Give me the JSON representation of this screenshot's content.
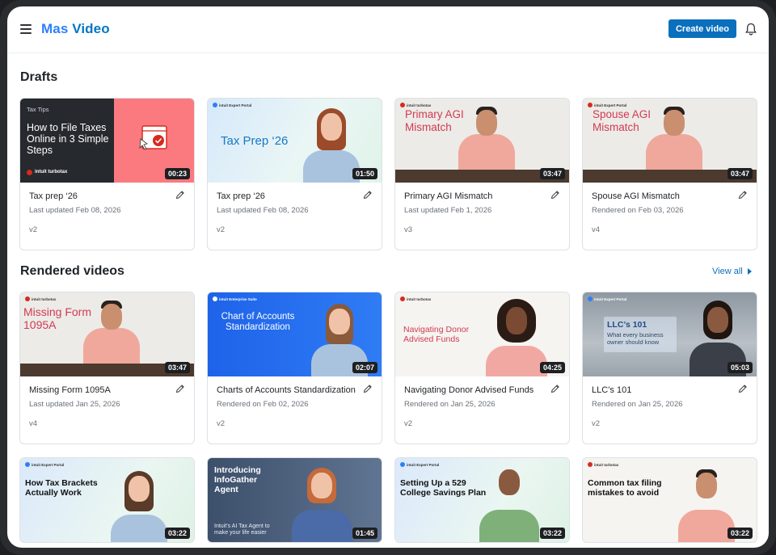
{
  "app": {
    "brand_part1": "Mas ",
    "brand_part2": "Video",
    "create_label": "Create video"
  },
  "sections": {
    "drafts": "Drafts",
    "rendered": "Rendered videos",
    "view_all": "View all"
  },
  "drafts": [
    {
      "title": "Tax prep ‘26",
      "subtitle": "Last updated Feb 08, 2026",
      "version": "v2",
      "duration": "00:23",
      "thumb_text": "How to File Taxes Online in 3 Simple Steps",
      "thumb_tag": "Tax Tips",
      "thumb_logo": "intuit turbotax"
    },
    {
      "title": "Tax prep ‘26",
      "subtitle": "Last updated Feb 08, 2026",
      "version": "v2",
      "duration": "01:50",
      "thumb_text": "Tax Prep ‘26",
      "thumb_logo": "intuit Expert Portal"
    },
    {
      "title": "Primary AGI Mismatch",
      "subtitle": "Last updated Feb 1, 2026",
      "version": "v3",
      "duration": "03:47",
      "thumb_text": "Primary AGI Mismatch",
      "thumb_logo": "intuit turbotax"
    },
    {
      "title": "Spouse AGI Mismatch",
      "subtitle": "Rendered on Feb 03, 2026",
      "version": "v4",
      "duration": "03:47",
      "thumb_text": "Spouse AGI Mismatch",
      "thumb_logo": "intuit Expert Portal"
    }
  ],
  "rendered": [
    {
      "title": "Missing Form 1095A",
      "subtitle": "Last updated Jan 25, 2026",
      "version": "v4",
      "duration": "03:47",
      "thumb_text": "Missing Form 1095A",
      "thumb_logo": "intuit turbotax"
    },
    {
      "title": "Charts of Accounts Standardization",
      "subtitle": "Rendered on Feb 02, 2026",
      "version": "v2",
      "duration": "02:07",
      "thumb_text": "Chart of Accounts Standardization",
      "thumb_logo": "intuit Enterprise Suite"
    },
    {
      "title": "Navigating Donor Advised Funds",
      "subtitle": "Rendered on Jan 25, 2026",
      "version": "v2",
      "duration": "04:25",
      "thumb_text": "Navigating Donor Advised Funds",
      "thumb_logo": "intuit turbotax"
    },
    {
      "title": "LLC’s 101",
      "subtitle": "Rendered on Jan 25, 2026",
      "version": "v2",
      "duration": "05:03",
      "thumb_text": "LLC’s 101",
      "thumb_sub": "What every business owner should know",
      "thumb_logo": "intuit Expert Portal"
    }
  ],
  "more": [
    {
      "duration": "03:22",
      "thumb_text": "How Tax Brackets Actually Work",
      "thumb_logo": "intuit Expert Portal"
    },
    {
      "duration": "01:45",
      "thumb_text": "Introducing InfoGather Agent",
      "thumb_sub": "Intuit’s AI Tax Agent to make your life easier",
      "thumb_logo": ""
    },
    {
      "duration": "03:22",
      "thumb_text": "Setting Up a 529 College Savings Plan",
      "thumb_logo": "intuit Expert Portal"
    },
    {
      "duration": "03:22",
      "thumb_text": "Common tax filing mistakes to avoid",
      "thumb_logo": "intuit turbotax"
    }
  ],
  "colors": {
    "accent": "#0a6fbd",
    "brand": "#2d7ff9",
    "turbotax_red": "#d52b1e"
  }
}
